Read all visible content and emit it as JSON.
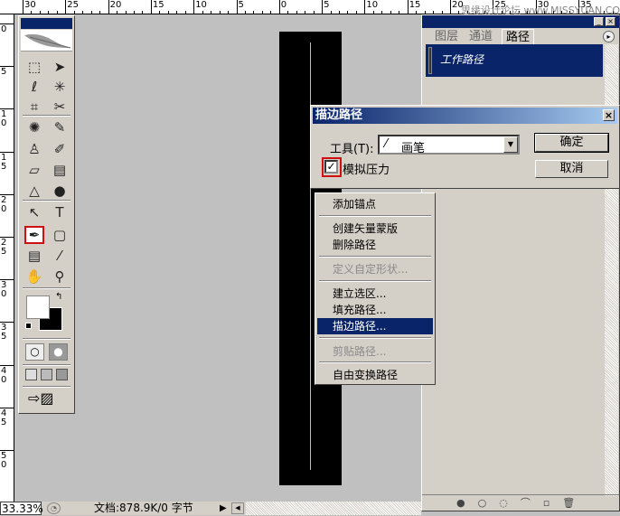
{
  "rulers": {
    "top_labels": [
      "30",
      "25",
      "20",
      "15",
      "10",
      "5",
      "0",
      "5",
      "10",
      "15",
      "20",
      "25",
      "30",
      "35"
    ],
    "left_labels": [
      "0",
      "5",
      "10",
      "15",
      "20",
      "25",
      "30",
      "35",
      "40",
      "45",
      "50"
    ]
  },
  "watermark": "思缘设计论坛 www.MISSYUAN.COM",
  "toolbox": {
    "tools": [
      "marquee",
      "move",
      "lasso",
      "magic-wand",
      "crop",
      "slice",
      "healing-brush",
      "brush",
      "clone-stamp",
      "history-brush",
      "eraser",
      "gradient",
      "blur",
      "dodge",
      "path-selection",
      "type",
      "pen",
      "shape",
      "notes",
      "eyedropper",
      "hand",
      "zoom"
    ],
    "selected_tool": "pen"
  },
  "paths_panel": {
    "tabs": [
      "图层",
      "通道",
      "路径"
    ],
    "active_tab": "路径",
    "items": [
      "工作路径"
    ]
  },
  "dialog": {
    "title": "描边路径",
    "tool_label": "工具(T):",
    "tool_value": "画笔",
    "simulate_pressure_label": "模拟压力",
    "simulate_pressure_checked": true,
    "ok_label": "确定",
    "cancel_label": "取消"
  },
  "context_menu": {
    "items": [
      {
        "label": "添加锚点"
      },
      {
        "label": "创建矢量蒙版"
      },
      {
        "label": "删除路径"
      },
      {
        "label": "定义自定形状...",
        "disabled": true
      },
      {
        "label": "建立选区..."
      },
      {
        "label": "填充路径..."
      },
      {
        "label": "描边路径...",
        "highlighted": true
      },
      {
        "label": "剪贴路径...",
        "disabled": true
      },
      {
        "label": "自由变换路径"
      }
    ]
  },
  "status": {
    "zoom": "33.33%",
    "doc_info": "文档:878.9K/0 字节"
  },
  "colors": {
    "title_blue": "#0a246a",
    "highlight_red": "#d01010",
    "canvas": "#c0c0c0"
  }
}
